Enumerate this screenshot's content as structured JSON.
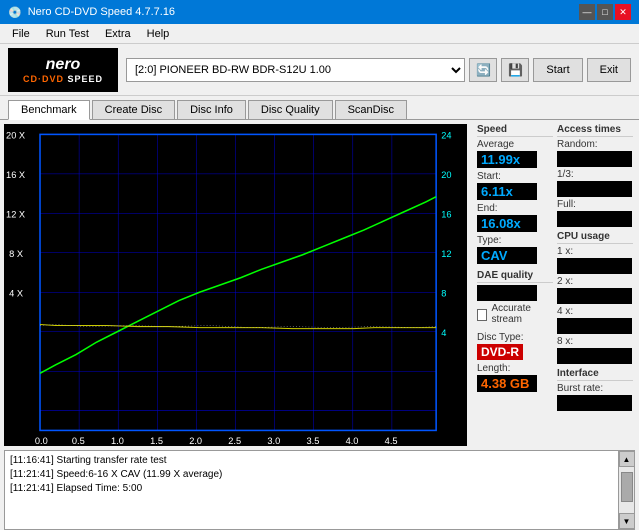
{
  "window": {
    "title": "Nero CD-DVD Speed 4.7.7.16",
    "controls": [
      "—",
      "□",
      "✕"
    ]
  },
  "menu": {
    "items": [
      "File",
      "Run Test",
      "Extra",
      "Help"
    ]
  },
  "drive": {
    "label": "[2:0]  PIONEER BD-RW   BDR-S12U 1.00",
    "start_btn": "Start",
    "exit_btn": "Exit"
  },
  "tabs": [
    "Benchmark",
    "Create Disc",
    "Disc Info",
    "Disc Quality",
    "ScanDisc"
  ],
  "active_tab": "Benchmark",
  "stats": {
    "speed_label": "Speed",
    "average_label": "Average",
    "average_value": "11.99x",
    "start_label": "Start:",
    "start_value": "6.11x",
    "end_label": "End:",
    "end_value": "16.08x",
    "type_label": "Type:",
    "type_value": "CAV",
    "dae_label": "DAE quality",
    "accurate_stream_label": "Accurate stream",
    "disc_type_label": "Disc Type:",
    "disc_type_value": "DVD-R",
    "length_label": "Length:",
    "length_value": "4.38 GB"
  },
  "access_times": {
    "label": "Access times",
    "random_label": "Random:",
    "one_third_label": "1/3:",
    "full_label": "Full:"
  },
  "cpu_usage": {
    "label": "CPU usage",
    "values": [
      "1 x:",
      "2 x:",
      "4 x:",
      "8 x:"
    ]
  },
  "interface": {
    "label": "Interface",
    "burst_label": "Burst rate:"
  },
  "log": {
    "lines": [
      "[11:16:41]  Starting transfer rate test",
      "[11:21:41]  Speed:6-16 X CAV (11.99 X average)",
      "[11:21:41]  Elapsed Time: 5:00"
    ]
  },
  "chart": {
    "y_axis_left": [
      "20 X",
      "16 X",
      "12 X",
      "8 X",
      "4 X"
    ],
    "y_axis_right": [
      "24",
      "20",
      "16",
      "12",
      "8",
      "4"
    ],
    "x_axis": [
      "0.0",
      "0.5",
      "1.0",
      "1.5",
      "2.0",
      "2.5",
      "3.0",
      "3.5",
      "4.0",
      "4.5"
    ],
    "title": ""
  }
}
